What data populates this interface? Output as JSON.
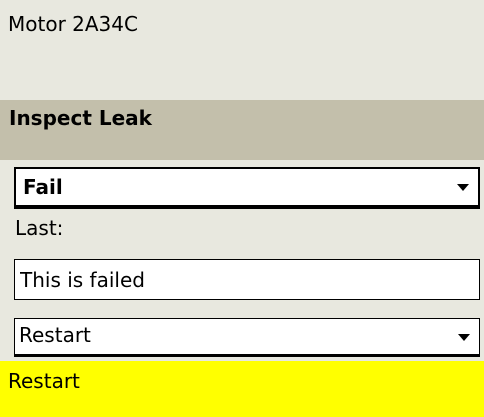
{
  "header": {
    "title": "Motor 2A34C"
  },
  "section": {
    "title": "Inspect Leak"
  },
  "status_select": {
    "value": "Fail"
  },
  "last": {
    "label": "Last:"
  },
  "note": {
    "value": "This is failed"
  },
  "action_select": {
    "value": "Restart"
  },
  "status_bar": {
    "text": "Restart",
    "color": "#ffff00"
  },
  "colors": {
    "background": "#e8e8df",
    "section_band": "#c3bfab"
  }
}
